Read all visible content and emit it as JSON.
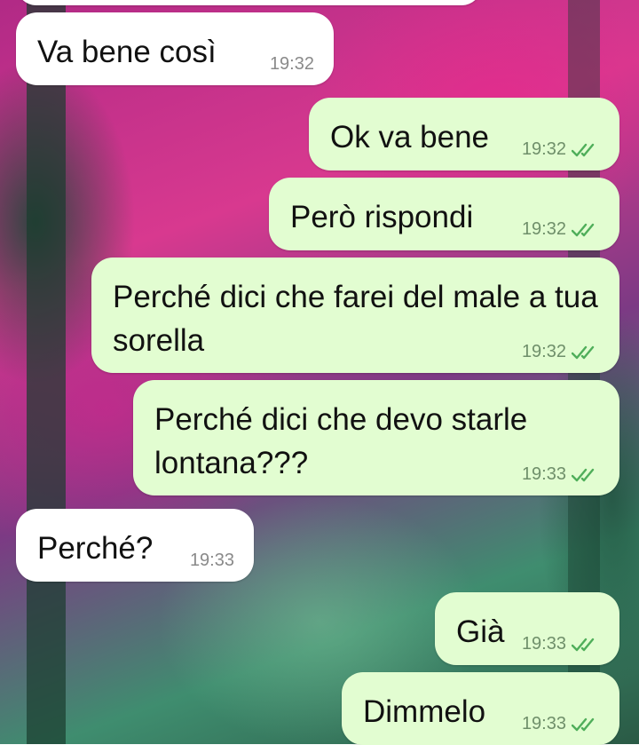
{
  "messages": [
    {
      "direction": "incoming",
      "text": "Va bene così",
      "time": "19:32"
    },
    {
      "direction": "outgoing",
      "text": "Ok va bene",
      "time": "19:32",
      "status": "read-double-check-icon"
    },
    {
      "direction": "outgoing",
      "text": "Però rispondi",
      "time": "19:32",
      "status": "read-double-check-icon"
    },
    {
      "direction": "outgoing",
      "text": "Perché dici che farei del male a tua sorella",
      "time": "19:32",
      "status": "read-double-check-icon"
    },
    {
      "direction": "outgoing",
      "text": "Perché dici che devo starle lontana???",
      "time": "19:33",
      "status": "read-double-check-icon"
    },
    {
      "direction": "incoming",
      "text": "Perché?",
      "time": "19:33"
    },
    {
      "direction": "outgoing",
      "text": "Già",
      "time": "19:33",
      "status": "read-double-check-icon"
    },
    {
      "direction": "outgoing",
      "text": "Dimmelo",
      "time": "19:33",
      "status": "read-double-check-icon"
    }
  ],
  "colors": {
    "incoming_bubble": "#ffffff",
    "outgoing_bubble": "#e2fdd1",
    "read_tick": "#4fae5a",
    "wallpaper_primary": "#d8398f",
    "wallpaper_secondary": "#3f8d6f"
  }
}
